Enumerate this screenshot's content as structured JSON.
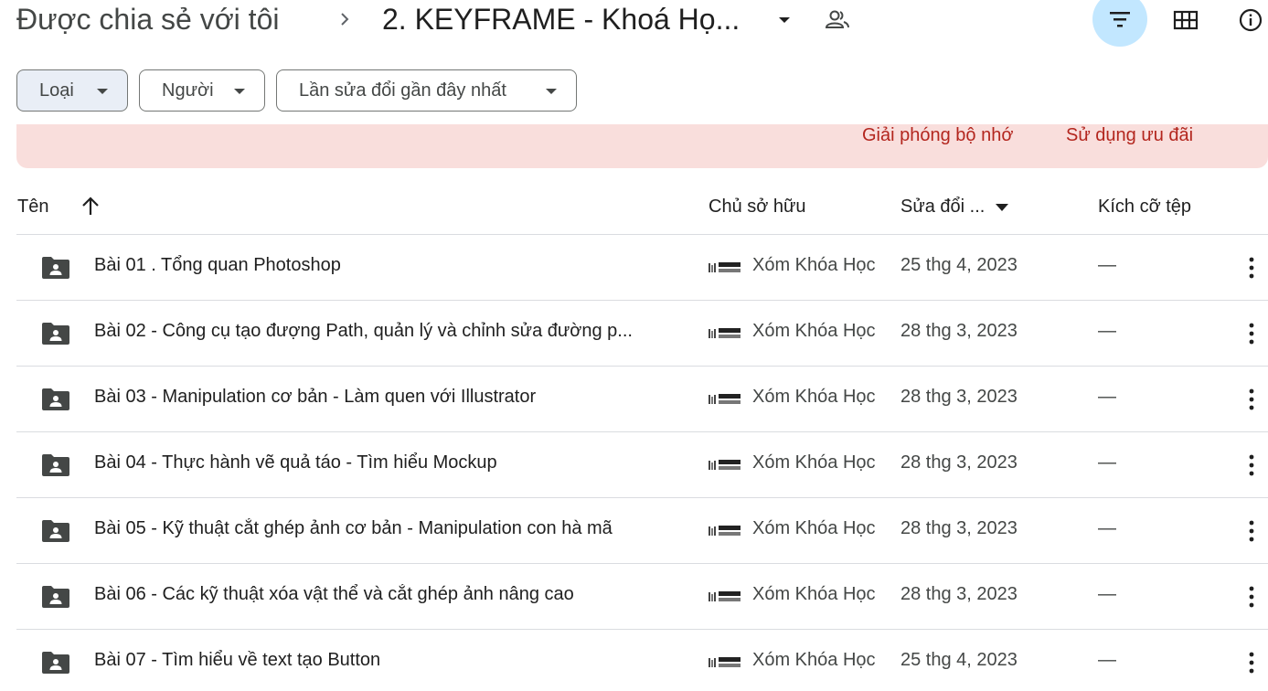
{
  "breadcrumb": {
    "root": "Được chia sẻ với tôi",
    "current": "2. KEYFRAME - Khoá Họ..."
  },
  "filters": {
    "type_label": "Loại",
    "people_label": "Người",
    "modified_label": "Lần sửa đổi gần đây nhất"
  },
  "banner": {
    "free_up_label": "Giải phóng bộ nhớ",
    "use_offer_label": "Sử dụng ưu đãi"
  },
  "table": {
    "headers": {
      "name": "Tên",
      "owner": "Chủ sở hữu",
      "modified": "Sửa đổi ...",
      "size": "Kích cỡ tệp"
    },
    "rows": [
      {
        "name": "Bài 01 . Tổng quan Photoshop",
        "owner": "Xóm Khóa Học",
        "modified": "25 thg 4, 2023",
        "size": "—"
      },
      {
        "name": "Bài 02 - Công cụ tạo đượng Path, quản lý và chỉnh sửa đường p...",
        "owner": "Xóm Khóa Học",
        "modified": "28 thg 3, 2023",
        "size": "—"
      },
      {
        "name": "Bài 03 - Manipulation cơ bản - Làm quen với Illustrator",
        "owner": "Xóm Khóa Học",
        "modified": "28 thg 3, 2023",
        "size": "—"
      },
      {
        "name": "Bài 04 - Thực hành vẽ quả táo - Tìm hiểu Mockup",
        "owner": "Xóm Khóa Học",
        "modified": "28 thg 3, 2023",
        "size": "—"
      },
      {
        "name": "Bài 05 - Kỹ thuật cắt ghép ảnh cơ bản - Manipulation con hà mã",
        "owner": "Xóm Khóa Học",
        "modified": "28 thg 3, 2023",
        "size": "—"
      },
      {
        "name": "Bài 06 - Các kỹ thuật xóa vật thể và cắt ghép ảnh nâng cao",
        "owner": "Xóm Khóa Học",
        "modified": "28 thg 3, 2023",
        "size": "—"
      },
      {
        "name": "Bài 07 - Tìm hiểu về text tạo Button",
        "owner": "Xóm Khóa Học",
        "modified": "25 thg 4, 2023",
        "size": "—"
      }
    ]
  },
  "icons": {
    "breadcrumb_separator": "chevron-right-icon",
    "breadcrumb_menu": "caret-down-icon",
    "shared": "people-icon",
    "filter": "filter-icon",
    "grid": "grid-view-icon",
    "info": "info-icon",
    "folder": "shared-folder-icon",
    "more": "more-vert-icon",
    "sort": "arrow-up-icon"
  },
  "colors": {
    "filter_active_bg": "#c2e7ff",
    "banner_bg": "#f9dedc",
    "banner_text": "#b3261e",
    "chip_active_bg": "#e9eef6"
  }
}
